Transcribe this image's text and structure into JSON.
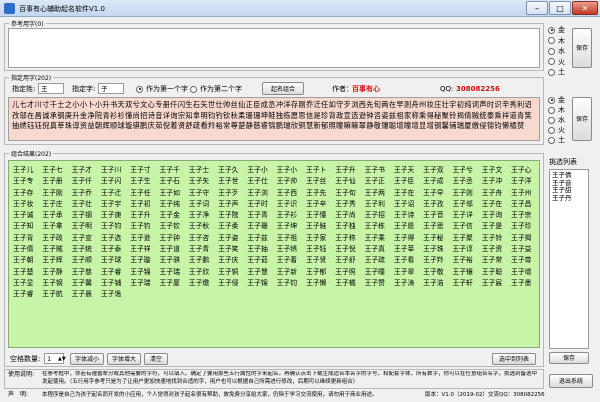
{
  "window": {
    "title": "百事有心辅助起名软件V1.0",
    "buttons": {
      "min": "–",
      "max": "□",
      "close": "✕"
    }
  },
  "reference": {
    "legend": "参考用字(0)",
    "text": "",
    "save_label": "保存",
    "radios": [
      {
        "label": "金",
        "checked": true
      },
      {
        "label": "木",
        "checked": false
      },
      {
        "label": "水",
        "checked": false
      },
      {
        "label": "火",
        "checked": false
      },
      {
        "label": "土",
        "checked": false
      }
    ]
  },
  "fixed": {
    "legend": "指定用字(202)",
    "surname_label": "指定姓:",
    "surname_value": "王",
    "char_label": "指定字:",
    "char_value": "子",
    "pos_first": "作为第一个字",
    "pos_second": "作为第二个字",
    "combine_label": "起名组合",
    "author_label": "作者：",
    "author_value": "百事有心",
    "qq_label": "QQ:",
    "qq_value": "308082256",
    "chars": "儿七才川寸千士之小小卜小升书天双兮文心专册仟闪生石矢世仕帅丝仙正臣成丞冲洋存刚乔迁任如守歹浏西先旬两在早则舟州妆庄壮宇初纯词声时识辛秀利诏孜邬在昌诚承钢庚升金净院青衫衫懂尚招诗音详询宗知拿明钧钓钦秋柔珊珊坤鲑独栋愿思信是珍背政宣选逊钟咨姿兹祖家称乘得秘聚铃揭倩贼统泰乘祥道青笑抽绣钰钰倪真莘珠谆资益朝辉顺球璇骐鹏庆茹倪着贤舒疏看羚裕常尊楚静慈睿锦鹏瑞欣铜慧新郁照瞳嘛嘛翠静敬镶聪增瞳增显增钢馨铺瑞厦缴侵锦钧懒橘赞",
    "save_label": "保存",
    "radios": [
      {
        "label": "金",
        "checked": true
      },
      {
        "label": "木",
        "checked": false
      },
      {
        "label": "水",
        "checked": false
      },
      {
        "label": "火",
        "checked": false
      },
      {
        "label": "土",
        "checked": false
      }
    ]
  },
  "results": {
    "legend": "组合结果(202)",
    "names": [
      "王子儿",
      "王子七",
      "王子才",
      "王子川",
      "王子寸",
      "王子千",
      "王子士",
      "王子久",
      "王子小",
      "王子小",
      "王子卜",
      "王子升",
      "王子书",
      "王子天",
      "王子双",
      "王子兮",
      "王子文",
      "王子心",
      "王子专",
      "王子册",
      "王子仟",
      "王子闪",
      "王子生",
      "王子石",
      "王子矢",
      "王子世",
      "王子仕",
      "王子帅",
      "王子丝",
      "王子仙",
      "王子正",
      "王子臣",
      "王子成",
      "王子丞",
      "王子冲",
      "王子洋",
      "王子存",
      "王子刚",
      "王子乔",
      "王子迁",
      "王子任",
      "王子如",
      "王子守",
      "王子歹",
      "王子浏",
      "王子西",
      "王子先",
      "王子旬",
      "王子两",
      "王子在",
      "王子早",
      "王子则",
      "王子舟",
      "王子州",
      "王子妆",
      "王子庄",
      "王子壮",
      "王子宇",
      "王子初",
      "王子纯",
      "王子词",
      "王子声",
      "王子时",
      "王子识",
      "王子辛",
      "王子秀",
      "王子利",
      "王子诏",
      "王子孜",
      "王子邬",
      "王子在",
      "王子昌",
      "王子诚",
      "王子承",
      "王子钢",
      "王子庚",
      "王子升",
      "王子金",
      "王子净",
      "王子院",
      "王子青",
      "王子衫",
      "王子懂",
      "王子尚",
      "王子招",
      "王子诗",
      "王子音",
      "王子详",
      "王子询",
      "王子宗",
      "王子知",
      "王子拿",
      "王子明",
      "王子钧",
      "王子钓",
      "王子钦",
      "王子秋",
      "王子柔",
      "王子珊",
      "王子坤",
      "王子鲑",
      "王子独",
      "王子栋",
      "王子愿",
      "王子思",
      "王子信",
      "王子是",
      "王子珍",
      "王子背",
      "王子政",
      "王子宣",
      "王子选",
      "王子逊",
      "王子钟",
      "王子咨",
      "王子姿",
      "王子兹",
      "王子祖",
      "王子家",
      "王子称",
      "王子乘",
      "王子得",
      "王子秘",
      "王子聚",
      "王子铃",
      "王子揭",
      "王子倩",
      "王子贼",
      "王子统",
      "王子泰",
      "王子祥",
      "王子道",
      "王子青",
      "王子笑",
      "王子抽",
      "王子绣",
      "王子钰",
      "王子倪",
      "王子真",
      "王子莘",
      "王子珠",
      "王子谆",
      "王子资",
      "王子益",
      "王子朝",
      "王子辉",
      "王子顺",
      "王子球",
      "王子璇",
      "王子骐",
      "王子鹏",
      "王子庆",
      "王子茹",
      "王子着",
      "王子贤",
      "王子舒",
      "王子疏",
      "王子看",
      "王子羚",
      "王子裕",
      "王子常",
      "王子尊",
      "王子楚",
      "王子静",
      "王子慈",
      "王子睿",
      "王子锦",
      "王子瑞",
      "王子欣",
      "王子铜",
      "王子慧",
      "王子新",
      "王子郁",
      "王子照",
      "王子瞳",
      "王子翠",
      "王子敬",
      "王子镶",
      "王子聪",
      "王子增",
      "王子显",
      "王子钢",
      "王子馨",
      "王子铺",
      "王子瑞",
      "王子厦",
      "王子缴",
      "王子侵",
      "王子锦",
      "王子钧",
      "王子懒",
      "王子橘",
      "王子赞",
      "王子涛",
      "王子浩",
      "王子轩",
      "王子宸",
      "王子墨",
      "王子睿",
      "王子航",
      "王子晨",
      "王子逸"
    ]
  },
  "selected": {
    "legend": "挑选列表",
    "items": [
      "王子倩",
      "王子音",
      "王子甜",
      "王子丹"
    ],
    "save_label": "保存"
  },
  "controls": {
    "spacing_label": "空格数量:",
    "spacing_value": "1",
    "font_smaller": "字体减小",
    "font_larger": "字体增大",
    "clear": "清空",
    "add_to_list": "选中到列表"
  },
  "help": {
    "label": "使用说明:",
    "text": "在参考框中，你若有遵循辈分或其他需要的字符，可以填入。确定了要用那些五行属性的字来起名。再确认点击下载生成适合本名字的字号，和配套字体，所有数字，你可以在任意组合名字，挑选到备选中发起使用。（五行用字参考只是为了让用户更加快速地找到合适的字，用户也可以根据自己所需进行修改，后期可以继续更新组合）"
  },
  "footer": {
    "label": "声　明:",
    "text": "本程序是自己为孩子起名而开发的小应用，个人觉得对孩子起名很有帮助，故免费分享给大家，仍除于学习交流使用，请勿用于商业用途。",
    "version": "版本：V1.0（2019-02）交流QQ：308082256",
    "exit_label": "退出系统"
  }
}
